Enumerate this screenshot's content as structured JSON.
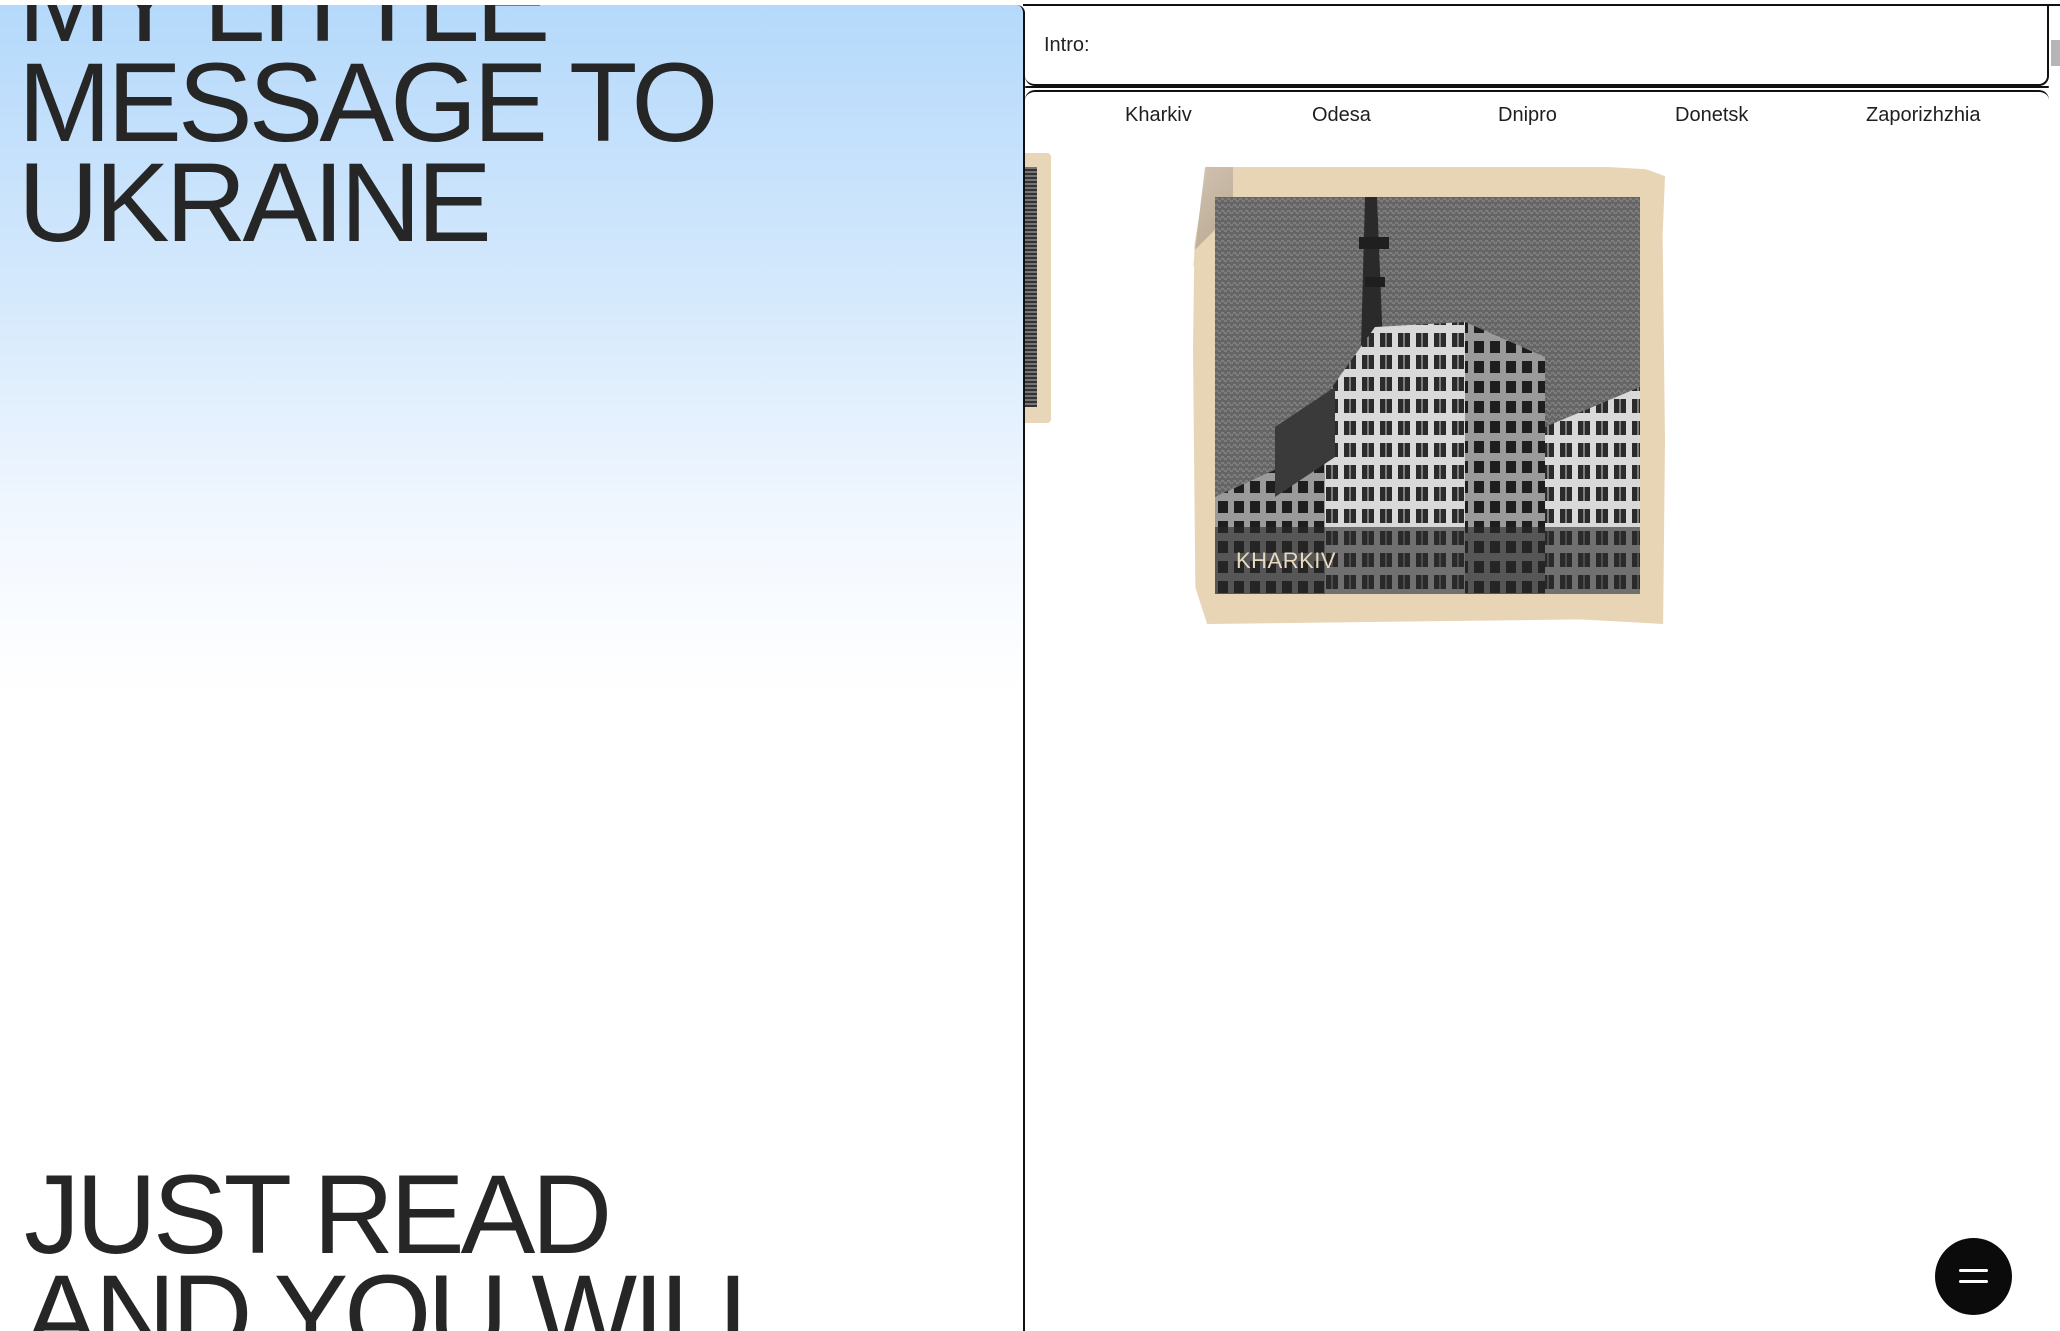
{
  "headline": {
    "lines": [
      "MY LITTLE",
      "MESSAGE TO",
      "UKRAINE"
    ]
  },
  "footline": {
    "lines": [
      "JUST READ",
      "AND YOU WILL"
    ]
  },
  "intro": {
    "label": "Intro:"
  },
  "city_tabs": [
    {
      "label": "Kharkiv"
    },
    {
      "label": "Odesa"
    },
    {
      "label": "Dnipro"
    },
    {
      "label": "Donetsk"
    },
    {
      "label": "Zaporizhzhia"
    }
  ],
  "card": {
    "caption": "KHARKIV"
  },
  "icons": {
    "menu": "menu-icon"
  },
  "colors": {
    "sky_top": "#b5d9fb",
    "card_paper": "#e8d5b6",
    "fab": "#0b0b0b",
    "text": "#262626"
  }
}
